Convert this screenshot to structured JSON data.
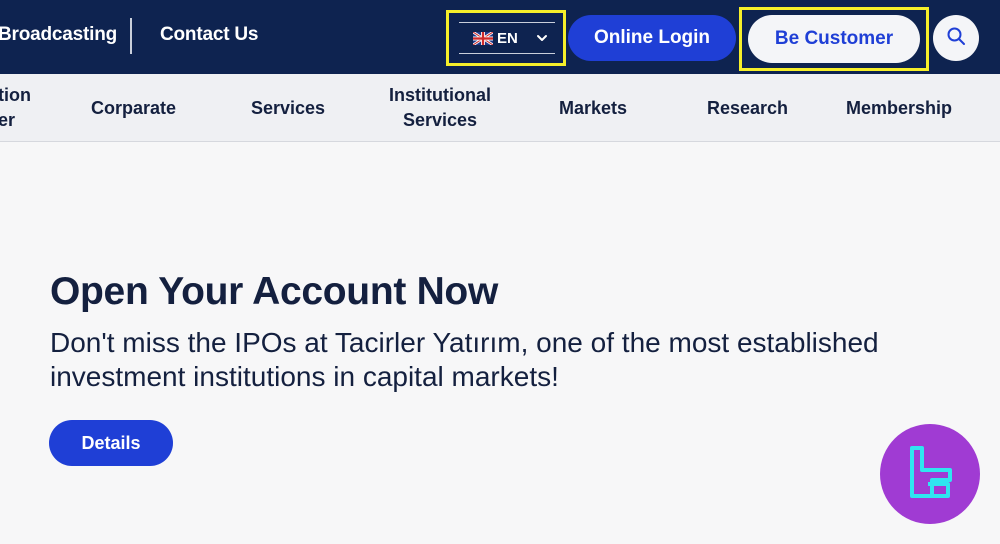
{
  "topbar": {
    "links": {
      "broadcasting": "Broadcasting",
      "contact": "Contact Us"
    },
    "language": {
      "code": "EN",
      "flag_icon": "uk-flag-icon"
    },
    "online_login": "Online Login",
    "be_customer": "Be Customer",
    "search_icon": "search-icon"
  },
  "nav": {
    "items": [
      {
        "line1": "tion",
        "line2": "er"
      },
      {
        "line1": "Corparate"
      },
      {
        "line1": "Services"
      },
      {
        "line1": "Institutional",
        "line2": "Services"
      },
      {
        "line1": "Markets"
      },
      {
        "line1": "Research"
      },
      {
        "line1": "Membership"
      }
    ]
  },
  "hero": {
    "title": "Open Your Account Now",
    "subtitle": "Don't miss the IPOs at Tacirler Yatırım, one of the most established investment institutions in capital markets!",
    "details_button": "Details"
  },
  "colors": {
    "topbar_bg": "#0e2350",
    "primary_blue": "#1f3fd6",
    "highlight_yellow": "#f6ef2a",
    "logo_purple": "#a03bd3",
    "logo_cyan": "#2fe6f0"
  }
}
